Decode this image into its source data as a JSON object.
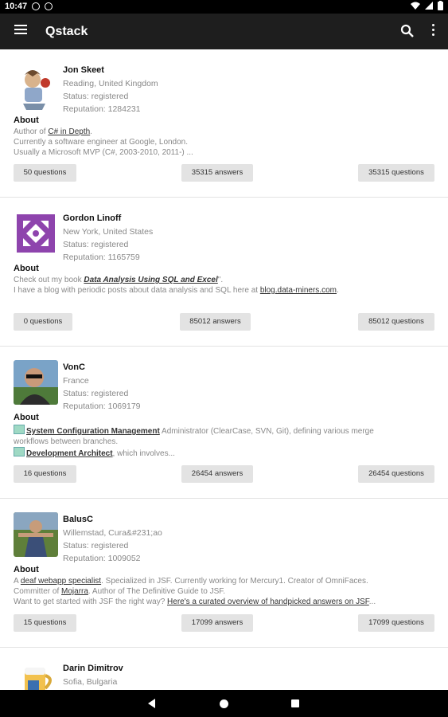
{
  "status_bar": {
    "time": "10:47"
  },
  "app_bar": {
    "title": "Qstack"
  },
  "users": [
    {
      "name": "Jon Skeet",
      "location": "Reading, United Kingdom",
      "status": "Status:  registered",
      "reputation": "Reputation:  1284231",
      "about_label": "About",
      "about_lines": [
        {
          "pre": "Author of ",
          "link": "C# in Depth",
          "post": "."
        },
        {
          "pre": "Currently a software engineer at Google, London.",
          "link": "",
          "post": ""
        },
        {
          "pre": "Usually a Microsoft MVP (C#, 2003-2010, 2011-) ...",
          "link": "",
          "post": ""
        }
      ],
      "questions_label": "50 questions",
      "answers_label": "35315 answers",
      "right_label": "35315 questions"
    },
    {
      "name": "Gordon Linoff",
      "location": "New York, United States",
      "status": "Status:  registered",
      "reputation": "Reputation:  1165759",
      "about_label": "About",
      "about_lines": [
        {
          "pre": "Check out my book ",
          "link": "Data Analysis Using SQL and Excel",
          "post": "\"."
        },
        {
          "pre": "I have a blog with periodic posts about data analysis and SQL here at ",
          "link": "blog.data-miners.com",
          "post": "."
        }
      ],
      "questions_label": "0 questions",
      "answers_label": "85012 answers",
      "right_label": "85012 questions"
    },
    {
      "name": "VonC",
      "location": "France",
      "status": "Status:  registered",
      "reputation": "Reputation:  1069179",
      "about_label": "About",
      "about_lines": [
        {
          "pre": "",
          "link": "System Configuration Management",
          "post": " Administrator (ClearCase, SVN, Git), defining various merge"
        },
        {
          "pre": "workflows between branches.",
          "link": "",
          "post": ""
        },
        {
          "pre": "",
          "link": "Development Architect",
          "post": ", which involves..."
        }
      ],
      "questions_label": "16 questions",
      "answers_label": "26454 answers",
      "right_label": "26454 questions"
    },
    {
      "name": "BalusC",
      "location": "Willemstad, Cura&#231;ao",
      "status": "Status:  registered",
      "reputation": "Reputation:  1009052",
      "about_label": "About",
      "about_lines": [
        {
          "pre": "A ",
          "link": "deaf webapp specialist",
          "post": ". Specialized in JSF. Currently working for Mercury1. Creator of OmniFaces."
        },
        {
          "pre": "Committer of ",
          "link": "Mojarra",
          "post": ". Author of The Definitive Guide to JSF."
        },
        {
          "pre": "Want to get started with JSF the right way? ",
          "link": "Here's a curated overview of handpicked answers on JSF",
          "post": "..."
        }
      ],
      "questions_label": "15 questions",
      "answers_label": "17099 answers",
      "right_label": "17099 questions"
    },
    {
      "name": "Darin Dimitrov",
      "location": "Sofia, Bulgaria"
    }
  ]
}
